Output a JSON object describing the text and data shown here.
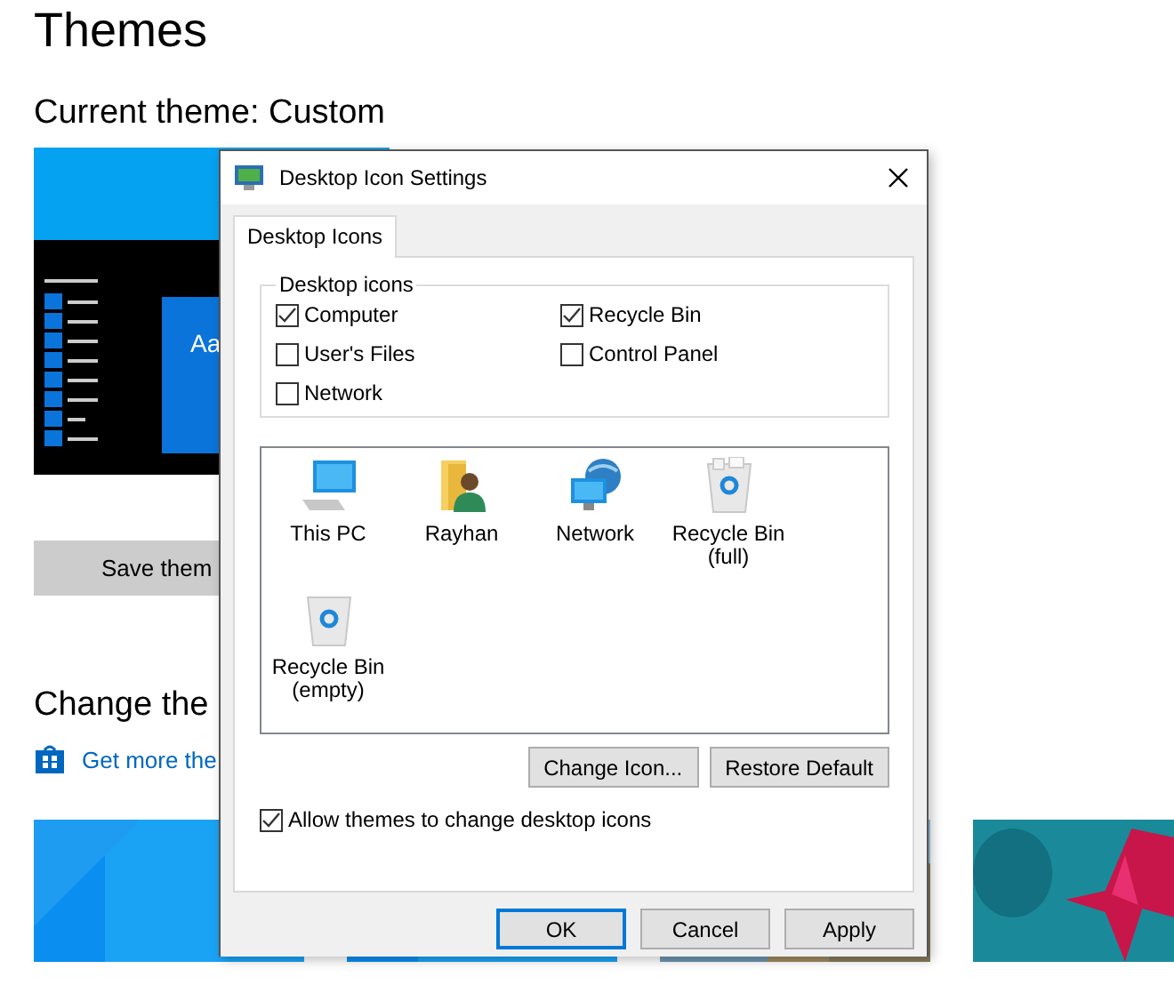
{
  "page": {
    "title": "Themes",
    "current_theme": "Current theme: Custom",
    "preview": {
      "sample_text": "Aa"
    },
    "save_button": "Save them",
    "change_heading": "Change the",
    "store_link": "Get more the"
  },
  "dialog": {
    "title": "Desktop Icon Settings",
    "tabs": [
      {
        "label": "Desktop Icons",
        "selected": true
      }
    ],
    "group": {
      "label": "Desktop icons",
      "options": [
        {
          "label": "Computer",
          "checked": true
        },
        {
          "label": "Recycle Bin",
          "checked": true
        },
        {
          "label": "User's Files",
          "checked": false
        },
        {
          "label": "Control Panel",
          "checked": false
        },
        {
          "label": "Network",
          "checked": false
        }
      ]
    },
    "icons": [
      {
        "kind": "pc",
        "label": "This PC",
        "selected": false
      },
      {
        "kind": "user",
        "label": "Rayhan",
        "selected": false
      },
      {
        "kind": "network",
        "label": "Network",
        "selected": false
      },
      {
        "kind": "bin-full",
        "label": "Recycle Bin\n(full)",
        "selected": false
      },
      {
        "kind": "bin-empty",
        "label": "Recycle Bin\n(empty)",
        "selected": false
      }
    ],
    "change_icon_button": "Change Icon...",
    "restore_default_button": "Restore Default",
    "allow_themes": {
      "label": "Allow themes to change desktop icons",
      "checked": true
    },
    "buttons": [
      {
        "label": "OK",
        "default": true
      },
      {
        "label": "Cancel",
        "default": false
      },
      {
        "label": "Apply",
        "default": false
      }
    ]
  }
}
